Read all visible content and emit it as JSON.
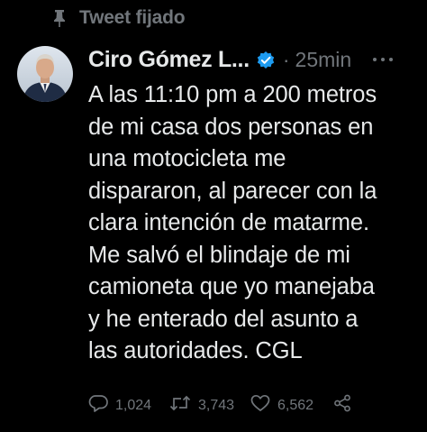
{
  "pinned": {
    "label": "Tweet fijado",
    "icon": "pin-icon"
  },
  "author": {
    "name": "Ciro Gómez L...",
    "verified_icon": "verified-badge-icon",
    "avatar_icon": "avatar"
  },
  "meta": {
    "separator": "·",
    "timestamp": "25min"
  },
  "tweet": {
    "lines": [
      "A las 11:10 pm a 200 metros",
      "de mi casa dos personas en",
      "una motocicleta me",
      "dispararon, al parecer con la",
      "clara intención de matarme.",
      "Me salvó el blindaje de mi",
      "camioneta que yo manejaba",
      "y he enterado del asunto a",
      "las autoridades. CGL"
    ]
  },
  "actions": {
    "replies": "1,024",
    "retweets": "3,743",
    "likes": "6,562"
  },
  "colors": {
    "background": "#000000",
    "text": "#e7e9ea",
    "muted": "#71767b",
    "verified": "#1d9bf0"
  }
}
